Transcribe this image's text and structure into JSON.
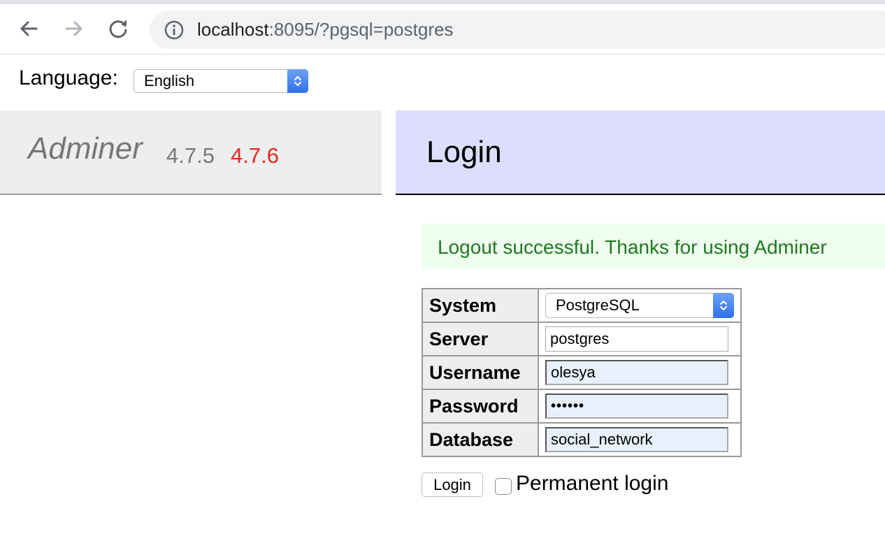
{
  "browser": {
    "url_host": "localhost",
    "url_path": ":8095/?pgsql=postgres",
    "icons": {
      "back": "arrow-left-icon",
      "forward": "arrow-right-icon",
      "reload": "reload-icon",
      "info": "info-circle-icon"
    }
  },
  "language": {
    "label": "Language:",
    "selected": "English"
  },
  "header": {
    "app_name": "Adminer",
    "version_current": "4.7.5",
    "version_new": "4.7.6",
    "page_title": "Login"
  },
  "message": "Logout successful. Thanks for using Adminer",
  "form": {
    "rows": [
      {
        "label": "System",
        "value": "PostgreSQL"
      },
      {
        "label": "Server",
        "value": "postgres"
      },
      {
        "label": "Username",
        "value": "olesya"
      },
      {
        "label": "Password",
        "value": "••••••"
      },
      {
        "label": "Database",
        "value": "social_network"
      }
    ],
    "submit_label": "Login",
    "permanent_label": "Permanent login"
  },
  "colors": {
    "header_bg": "#eeeeee",
    "content_header_bg": "#dddeff",
    "message_bg": "#eeffee",
    "message_text": "#227722",
    "new_version": "#e3281f",
    "autofill_bg": "#e8f0fe",
    "select_accent": "#2e70e8"
  }
}
